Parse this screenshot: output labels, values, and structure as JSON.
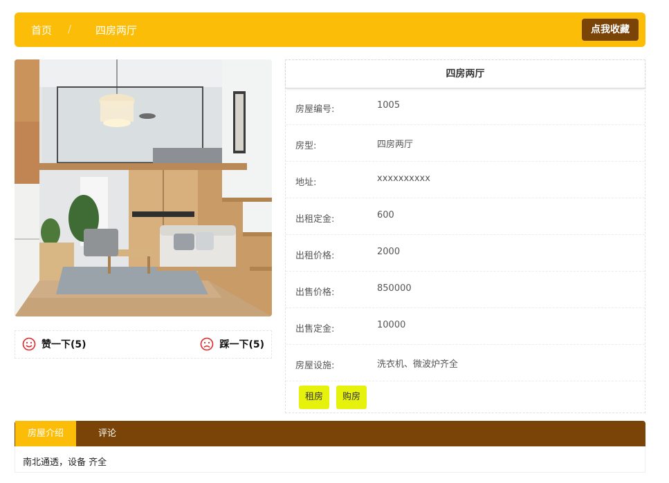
{
  "breadcrumb": {
    "home": "首页",
    "separator": "/",
    "current": "四房两厅"
  },
  "favorite_button": "点我收藏",
  "votes": {
    "like_label": "赞一下(5)",
    "dislike_label": "踩一下(5)",
    "icon_color": "#e0262a"
  },
  "detail": {
    "title": "四房两厅",
    "rows": [
      {
        "label": "房屋编号:",
        "value": "1005"
      },
      {
        "label": "房型:",
        "value": "四房两厅"
      },
      {
        "label": "地址:",
        "value": "xxxxxxxxxx"
      },
      {
        "label": "出租定金:",
        "value": "600"
      },
      {
        "label": "出租价格:",
        "value": "2000"
      },
      {
        "label": "出售价格:",
        "value": "850000"
      },
      {
        "label": "出售定金:",
        "value": "10000"
      },
      {
        "label": "房屋设施:",
        "value": "洗衣机、微波炉齐全"
      }
    ],
    "rent_button": "租房",
    "buy_button": "购房"
  },
  "tabs": {
    "intro": "房屋介绍",
    "comment": "评论",
    "active": "房屋介绍"
  },
  "intro_text": "南北通透，设备 齐全",
  "colors": {
    "accent": "#fbbd08",
    "brown": "#7a4307",
    "action": "#e6f20c"
  }
}
